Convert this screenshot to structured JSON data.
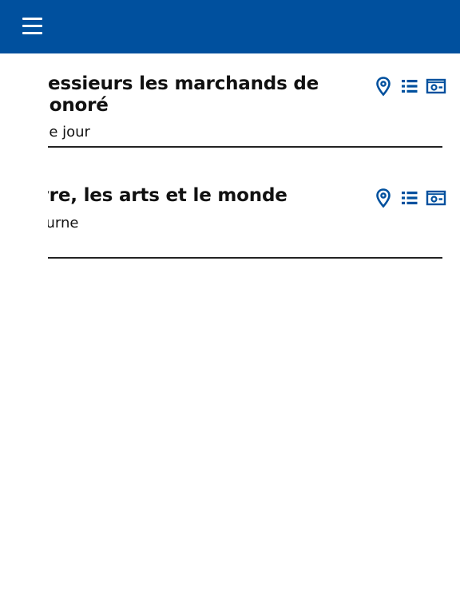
{
  "header": {
    "menu_icon": "hamburger-menu-icon",
    "background_color": "#00509e"
  },
  "items": [
    {
      "title": "Chez messieurs les marchands de Saint-Honoré",
      "subtitle": "Parcours de jour",
      "icons": [
        "map-pin-icon",
        "list-icon",
        "ticket-icon"
      ]
    },
    {
      "title": "Le Louvre, les arts et le monde",
      "subtitle": "Visite nocturne",
      "icons": [
        "map-pin-icon",
        "list-icon",
        "ticket-icon"
      ]
    }
  ],
  "colors": {
    "accent": "#00509e",
    "text": "#111111",
    "divider": "#222222"
  }
}
